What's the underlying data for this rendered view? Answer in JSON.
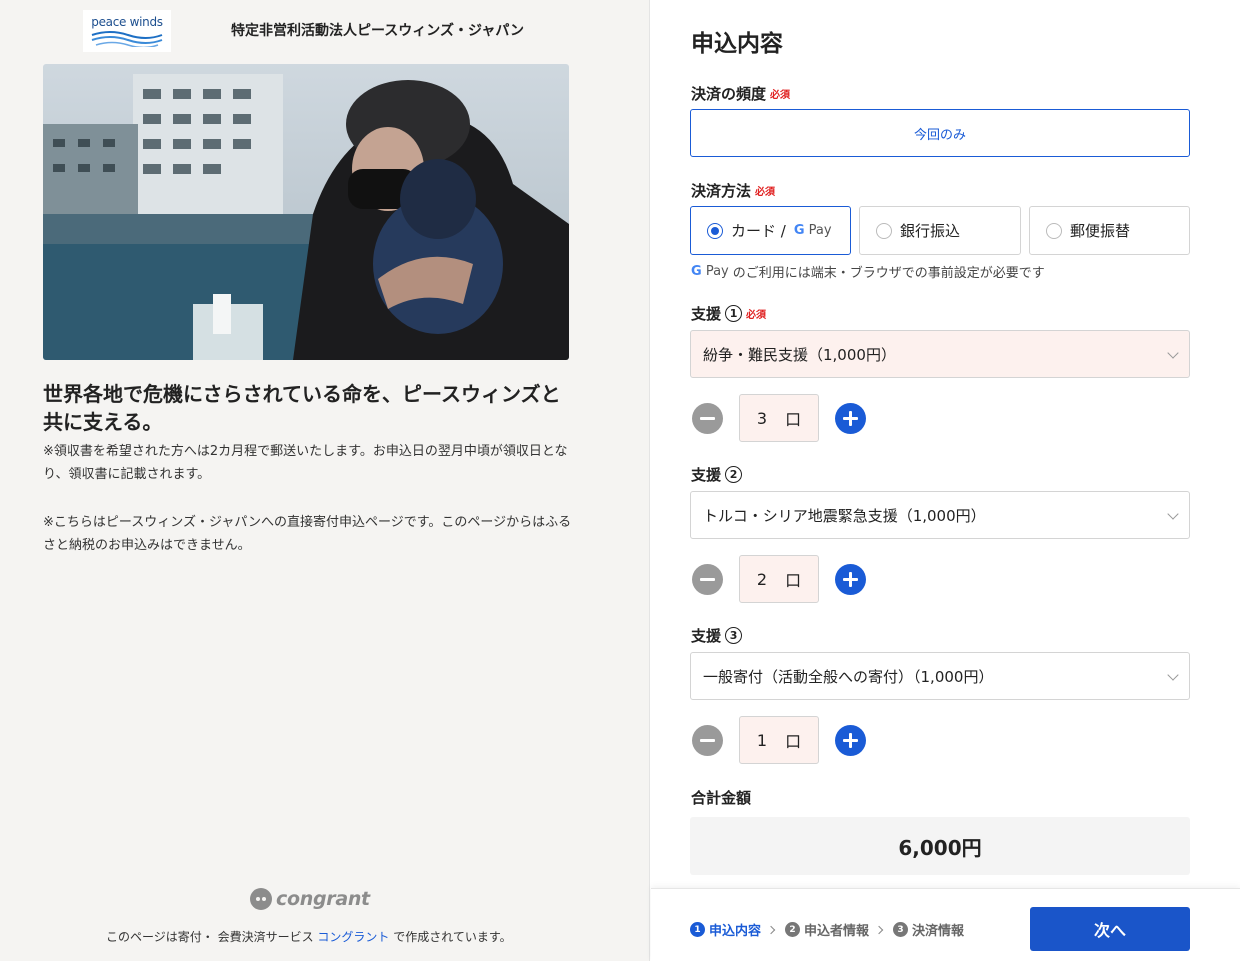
{
  "org": {
    "logo_text": "peace winds",
    "name": "特定非営利活動法人ピースウィンズ・ジャパン"
  },
  "left": {
    "headline": "世界各地で危機にさらされている命を、ピースウィンズと共に支える。",
    "note1": "※領収書を希望された方へは2カ月程で郵送いたします。お申込日の翌月中頃が領収日となり、領収書に記載されます。",
    "note2": "※こちらはピースウィンズ・ジャパンへの直接寄付申込ページです。このページからはふるさと納税のお申込みはできません。",
    "footer_brand": "congrant",
    "footer_prefix": "このページは寄付・ 会費決済サービス ",
    "footer_link": "コングラント",
    "footer_suffix": " で作成されています。"
  },
  "form": {
    "title": "申込内容",
    "required": "必須",
    "frequency": {
      "label": "決済の頻度",
      "selected": "今回のみ"
    },
    "payment": {
      "label": "決済方法",
      "options": [
        {
          "label": "カード /",
          "gpay": "Pay",
          "selected": true
        },
        {
          "label": "銀行振込",
          "selected": false
        },
        {
          "label": "郵便振替",
          "selected": false
        }
      ],
      "note_pay": "Pay",
      "note": "のご利用には端末・ブラウザでの事前設定が必要です"
    },
    "supports": [
      {
        "label": "支援",
        "num": "1",
        "required": true,
        "value": "紛争・難民支援（1,000円）",
        "qty": "3",
        "unit": "口"
      },
      {
        "label": "支援",
        "num": "2",
        "required": false,
        "value": "トルコ・シリア地震緊急支援（1,000円）",
        "qty": "2",
        "unit": "口"
      },
      {
        "label": "支援",
        "num": "3",
        "required": false,
        "value": "一般寄付（活動全般への寄付）（1,000円）",
        "qty": "1",
        "unit": "口"
      }
    ],
    "total": {
      "label": "合計金額",
      "value": "6,000円"
    }
  },
  "footer": {
    "steps": [
      {
        "num": "1",
        "label": "申込内容",
        "active": true
      },
      {
        "num": "2",
        "label": "申込者情報",
        "active": false
      },
      {
        "num": "3",
        "label": "決済情報",
        "active": false
      }
    ],
    "next_label": "次へ"
  },
  "colors": {
    "accent": "#1a5bd6",
    "required": "#e02020",
    "selected_bg": "#fdf1ee"
  }
}
